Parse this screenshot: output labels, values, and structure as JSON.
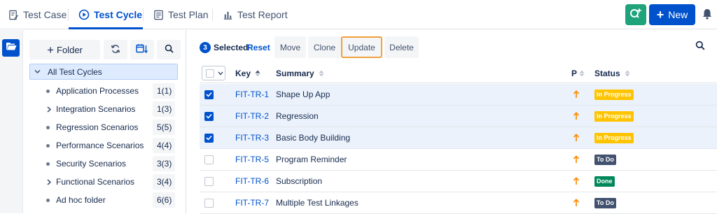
{
  "tabs": [
    {
      "label": "Test Case",
      "icon": "edit-doc-icon"
    },
    {
      "label": "Test Cycle",
      "icon": "play-circle-icon",
      "active": true
    },
    {
      "label": "Test Plan",
      "icon": "list-doc-icon"
    },
    {
      "label": "Test Report",
      "icon": "bar-chart-icon"
    }
  ],
  "header": {
    "new_label": "New"
  },
  "tree": {
    "folder_label": "Folder",
    "root_label": "All Test Cycles",
    "items": [
      {
        "label": "Application Processes",
        "count": "1(1)",
        "marker": "dot"
      },
      {
        "label": "Integration Scenarios",
        "count": "1(3)",
        "marker": "chevron"
      },
      {
        "label": "Regression Scenarios",
        "count": "5(5)",
        "marker": "dot"
      },
      {
        "label": "Performance Scenarios",
        "count": "4(4)",
        "marker": "dot"
      },
      {
        "label": "Security Scenarios",
        "count": "3(3)",
        "marker": "dot"
      },
      {
        "label": "Functional Scenarios",
        "count": "3(4)",
        "marker": "chevron"
      },
      {
        "label": "Ad hoc folder",
        "count": "6(6)",
        "marker": "dot"
      }
    ]
  },
  "toolbar": {
    "selected_count": "3",
    "selected_label": "Selected",
    "reset_label": "Reset",
    "move_label": "Move",
    "clone_label": "Clone",
    "update_label": "Update",
    "delete_label": "Delete"
  },
  "table": {
    "columns": {
      "key": "Key",
      "summary": "Summary",
      "priority": "P",
      "status": "Status"
    },
    "rows": [
      {
        "key": "FIT-TR-1",
        "summary": "Shape Up App",
        "status": "In Progress",
        "selected": true
      },
      {
        "key": "FIT-TR-2",
        "summary": "Regression",
        "status": "In Progress",
        "selected": true
      },
      {
        "key": "FIT-TR-3",
        "summary": "Basic Body Building",
        "status": "In Progress",
        "selected": true
      },
      {
        "key": "FIT-TR-5",
        "summary": "Program Reminder",
        "status": "To Do",
        "selected": false
      },
      {
        "key": "FIT-TR-6",
        "summary": "Subscription",
        "status": "Done",
        "selected": false
      },
      {
        "key": "FIT-TR-7",
        "summary": "Multiple Test Linkages",
        "status": "To Do",
        "selected": false
      }
    ]
  },
  "colors": {
    "accent": "#0052cc",
    "in_progress_bg": "#ffc400",
    "todo_bg": "#42526e",
    "done_bg": "#00875a",
    "priority": "#ff8b00",
    "highlight_border": "#f0a03c"
  }
}
